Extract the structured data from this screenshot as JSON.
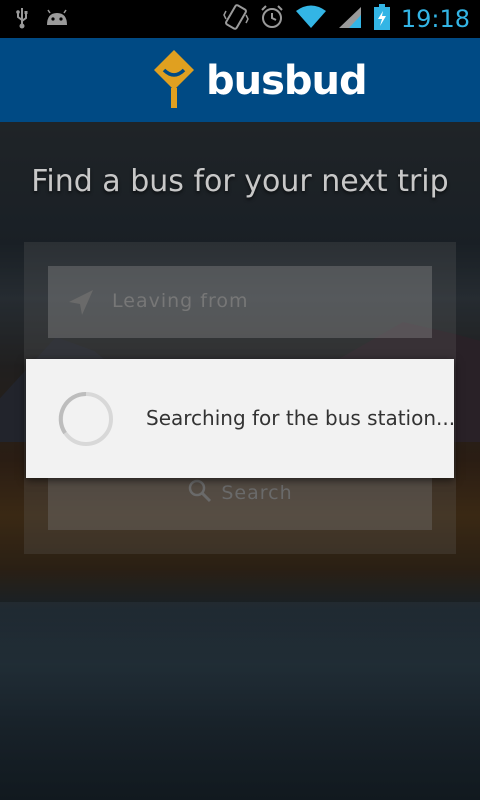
{
  "status_bar": {
    "time": "19:18",
    "icons": [
      "usb-icon",
      "android-debug-icon",
      "vibrate-icon",
      "alarm-icon",
      "wifi-icon",
      "signal-icon",
      "battery-charging-icon"
    ]
  },
  "app_bar": {
    "logo_text": "busbud"
  },
  "main": {
    "headline": "Find a bus for your next trip",
    "leaving_from_placeholder": "Leaving from",
    "search_label": "Search"
  },
  "dialog": {
    "message": "Searching for the bus station..."
  },
  "colors": {
    "app_bar": "#004a84",
    "logo_accent": "#e0a020",
    "status_accent": "#33b5e5",
    "dialog_bg": "#f2f2f2"
  }
}
